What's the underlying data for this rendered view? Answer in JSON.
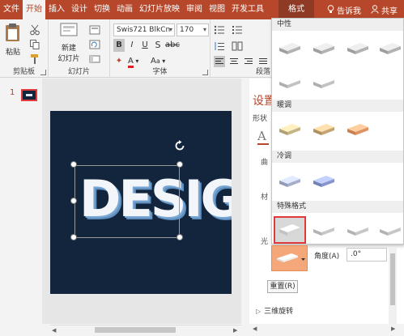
{
  "tabs": [
    {
      "label": "文件"
    },
    {
      "label": "开始"
    },
    {
      "label": "插入"
    },
    {
      "label": "设计"
    },
    {
      "label": "切换"
    },
    {
      "label": "动画"
    },
    {
      "label": "幻灯片放映"
    },
    {
      "label": "审阅"
    },
    {
      "label": "视图"
    },
    {
      "label": "开发工具"
    }
  ],
  "format_tab": "格式",
  "tell_me": "告诉我",
  "share": "共享",
  "ribbon": {
    "clipboard": {
      "paste": "粘贴",
      "label": "剪贴板"
    },
    "slides": {
      "new_slide_line1": "新建",
      "new_slide_line2": "幻灯片",
      "label": "幻灯片"
    },
    "font": {
      "name": "Swis721 BlkCn",
      "size": "170",
      "label": "字体",
      "aa_grow": "A",
      "aa_shrink": "A"
    },
    "paragraph": {
      "label": "段落"
    }
  },
  "slide_panel": {
    "number": "1"
  },
  "slide": {
    "text": "DESIGN",
    "bg": "#13253d",
    "text_color": "#f2f5f9",
    "shadow_color": "#6b9bcb"
  },
  "format_pane": {
    "title": "设置",
    "subtitle": "形状",
    "label_a": "A",
    "side_labels": [
      "曲",
      "材",
      "光"
    ]
  },
  "gallery": {
    "sections": [
      {
        "title": "中性",
        "count": 6
      },
      {
        "title": "暖调",
        "count": 3
      },
      {
        "title": "冷调",
        "count": 2
      },
      {
        "title": "特殊格式",
        "count": 7
      }
    ],
    "selected_section": 3,
    "selected_index": 0,
    "colors": {
      "neutral": "#b8b8b8",
      "warm": [
        "#c9b98b",
        "#c9a978",
        "#e39868"
      ],
      "cool": [
        "#aab3cf",
        "#8c9ad1"
      ]
    }
  },
  "below_gallery": {
    "angle_label": "角度(A)",
    "angle_value": ".0°",
    "reset_label": "重置(R)",
    "rotation_label": "三维旋转"
  }
}
